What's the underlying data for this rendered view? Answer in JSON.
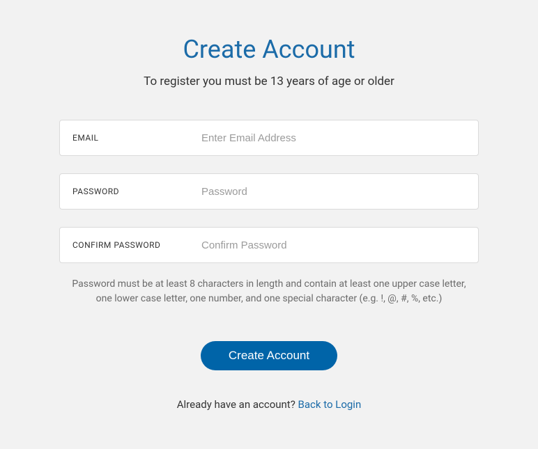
{
  "header": {
    "title": "Create Account",
    "subtitle": "To register you must be 13 years of age or older"
  },
  "fields": {
    "email": {
      "label": "EMAIL",
      "placeholder": "Enter Email Address",
      "value": ""
    },
    "password": {
      "label": "PASSWORD",
      "placeholder": "Password",
      "value": ""
    },
    "confirm_password": {
      "label": "CONFIRM PASSWORD",
      "placeholder": "Confirm Password",
      "value": ""
    }
  },
  "hint": "Password must be at least 8 characters in length and contain at least one upper case letter, one lower case letter, one number, and one special character (e.g. !, @, #, %, etc.)",
  "submit_label": "Create Account",
  "footer": {
    "prefix": "Already have an account? ",
    "link": "Back to Login"
  }
}
